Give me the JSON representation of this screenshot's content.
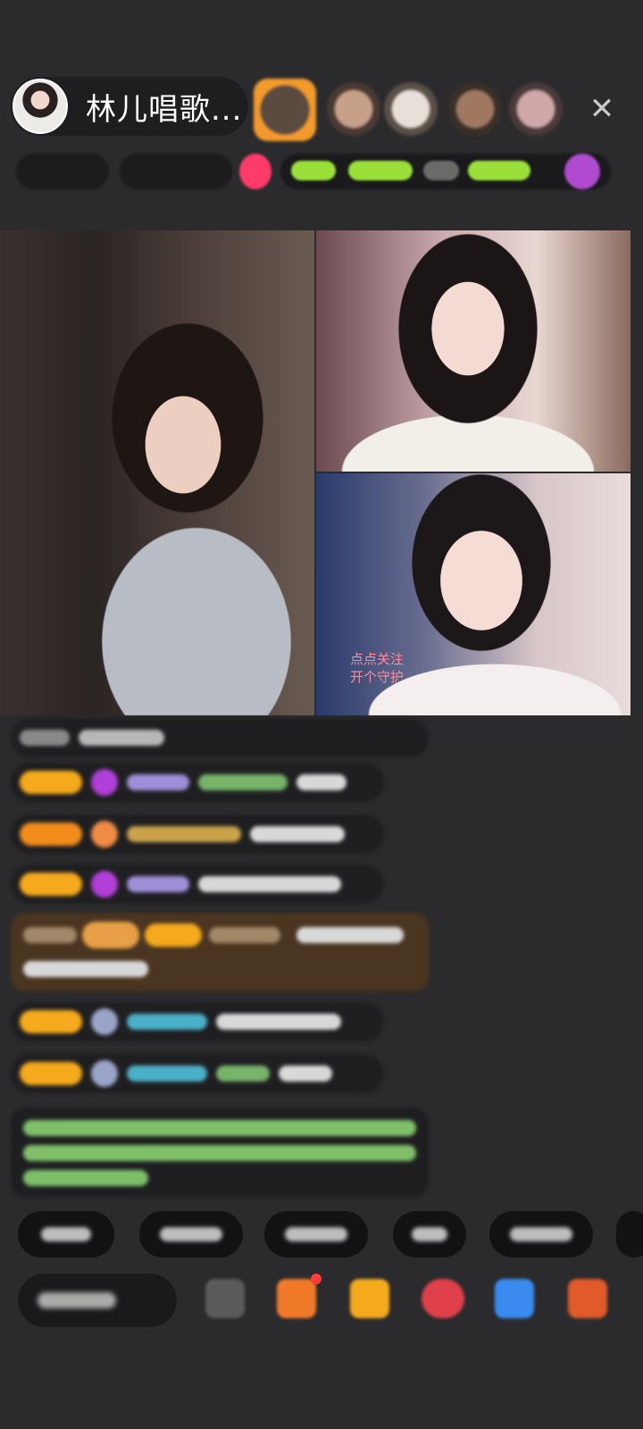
{
  "header": {
    "host_name": "林儿唱歌...",
    "close_icon": "close-icon"
  },
  "video": {
    "follow_prompt_line1": "点点关注",
    "follow_prompt_line2": "开个守护"
  },
  "colors": {
    "background": "#2b2b2d",
    "badge_gold": "#f5a91c",
    "follow_text": "#ff8aa0",
    "gift_message_bg": "#4a3520"
  }
}
